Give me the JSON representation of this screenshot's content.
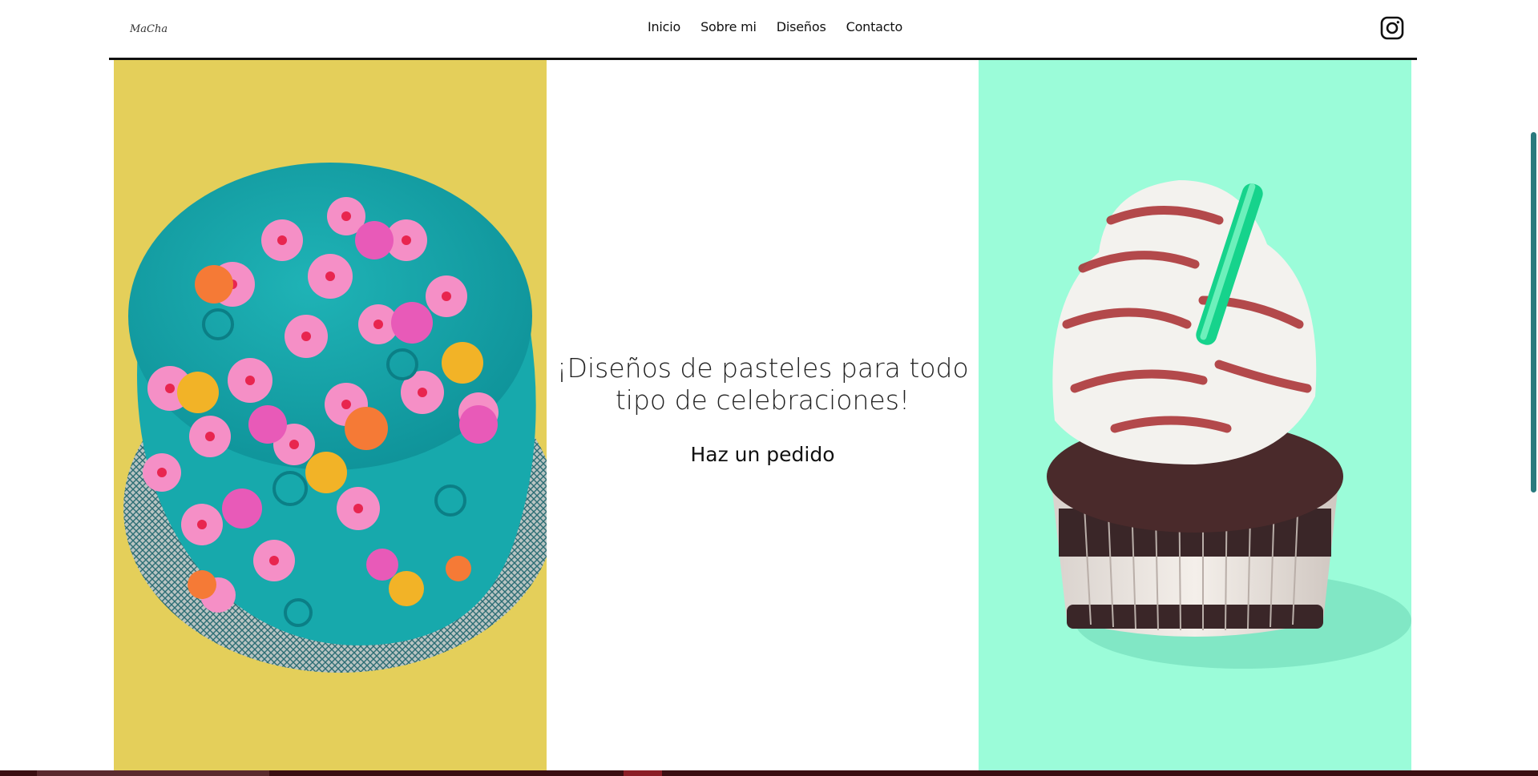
{
  "header": {
    "logo_text": "MaCha",
    "nav": [
      {
        "label": "Inicio"
      },
      {
        "label": "Sobre mi"
      },
      {
        "label": "Diseños"
      },
      {
        "label": "Contacto"
      }
    ],
    "social_icon": "instagram-icon"
  },
  "hero": {
    "title": "¡Diseños de pasteles para todo tipo de celebraciones!",
    "cta_label": "Haz un pedido",
    "left_image": "cake-image",
    "right_image": "cupcake-image"
  },
  "colors": {
    "left_panel_bg": "#e4cf5a",
    "right_panel_bg": "#9bfcd9",
    "accent_line": "#111111",
    "scrollbar": "#2a7a7e"
  }
}
